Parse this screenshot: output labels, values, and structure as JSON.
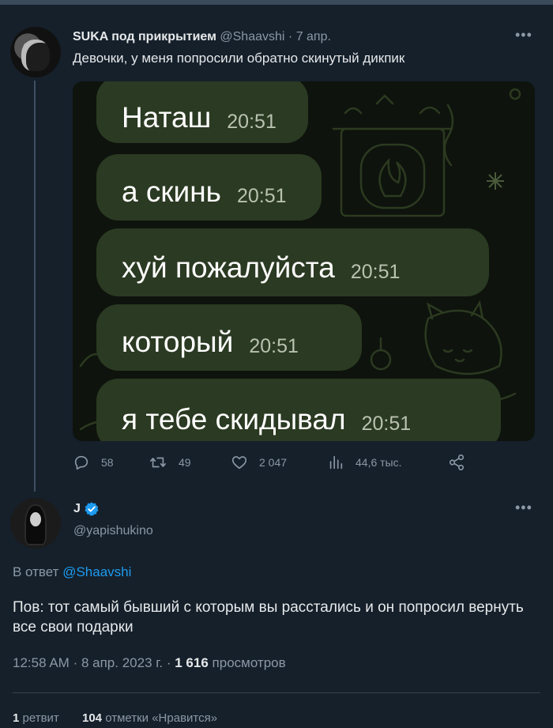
{
  "tweet": {
    "author_name": "SUKA под прикрытием",
    "author_handle": "@Shaavshi",
    "date": "7 апр.",
    "text": "Девочки, у меня попросили обратно скинутый дикпик",
    "chat_messages": [
      {
        "text": "Наташ",
        "time": "20:51"
      },
      {
        "text": "а скинь",
        "time": "20:51"
      },
      {
        "text": "хуй пожалуйста",
        "time": "20:51"
      },
      {
        "text": "который",
        "time": "20:51"
      },
      {
        "text": "я тебе скидывал",
        "time": "20:51"
      }
    ],
    "actions": {
      "replies": "58",
      "retweets": "49",
      "likes": "2 047",
      "views": "44,6 тыс."
    }
  },
  "reply": {
    "author_name": "J",
    "author_handle": "@yapishukino",
    "reply_prefix": "В ответ",
    "reply_to": "@Shaavshi",
    "text": "Пов: тот самый бывший с которым вы расстались и он попросил вернуть все свои подарки",
    "time": "12:58 AM",
    "date": "8 апр. 2023 г.",
    "views_count": "1 616",
    "views_label": "просмотров",
    "retweets_count": "1",
    "retweets_label": "ретвит",
    "likes_count": "104",
    "likes_label": "отметки «Нравится»"
  },
  "colors": {
    "background": "#15202b",
    "accent": "#1d9bf0",
    "muted": "#8b98a5",
    "bubble": "#2b3a22"
  }
}
